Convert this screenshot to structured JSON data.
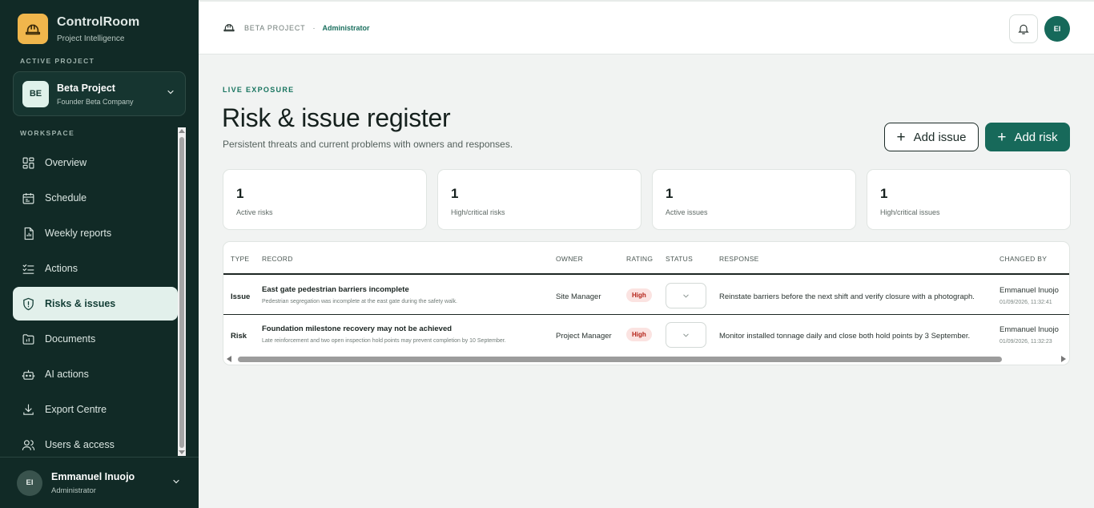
{
  "brand": {
    "name": "ControlRoom",
    "subtitle": "Project Intelligence",
    "icon": "hard-hat-icon",
    "color": "#f0b64c"
  },
  "sidebar": {
    "active_project_label": "ACTIVE PROJECT",
    "project": {
      "badge": "BE",
      "name": "Beta Project",
      "company": "Founder Beta Company"
    },
    "workspace_label": "WORKSPACE",
    "items": [
      {
        "label": "Overview",
        "icon": "grid-icon"
      },
      {
        "label": "Schedule",
        "icon": "calendar-icon"
      },
      {
        "label": "Weekly reports",
        "icon": "report-icon"
      },
      {
        "label": "Actions",
        "icon": "checklist-icon"
      },
      {
        "label": "Risks & issues",
        "icon": "shield-icon",
        "active": true
      },
      {
        "label": "Documents",
        "icon": "folder-icon"
      },
      {
        "label": "AI actions",
        "icon": "robot-icon"
      },
      {
        "label": "Export Centre",
        "icon": "download-icon"
      },
      {
        "label": "Users & access",
        "icon": "users-icon"
      }
    ],
    "user": {
      "initials": "EI",
      "name": "Emmanuel Inuojo",
      "role": "Administrator"
    }
  },
  "topbar": {
    "breadcrumb_project": "BETA PROJECT",
    "breadcrumb_separator": "·",
    "breadcrumb_role": "Administrator",
    "avatar_initials": "EI"
  },
  "page": {
    "eyebrow": "LIVE EXPOSURE",
    "title": "Risk & issue register",
    "subtitle": "Persistent threats and current problems with owners and responses.",
    "add_issue_label": "Add issue",
    "add_risk_label": "Add risk",
    "plus": "+"
  },
  "stats": [
    {
      "value": "1",
      "label": "Active risks"
    },
    {
      "value": "1",
      "label": "High/critical risks"
    },
    {
      "value": "1",
      "label": "Active issues"
    },
    {
      "value": "1",
      "label": "High/critical issues"
    }
  ],
  "table": {
    "headers": [
      "TYPE",
      "RECORD",
      "OWNER",
      "RATING",
      "STATUS",
      "RESPONSE",
      "CHANGED BY"
    ],
    "rows": [
      {
        "type": "Issue",
        "title": "East gate pedestrian barriers incomplete",
        "description": "Pedestrian segregation was incomplete at the east gate during the safety walk.",
        "owner": "Site Manager",
        "rating": "High",
        "response": "Reinstate barriers before the next shift and verify closure with a photograph.",
        "changed_by": "Emmanuel Inuojo",
        "changed_at": "01/09/2026, 11:32:41"
      },
      {
        "type": "Risk",
        "title": "Foundation milestone recovery may not be achieved",
        "description": "Late reinforcement and two open inspection hold points may prevent completion by 10 September.",
        "owner": "Project Manager",
        "rating": "High",
        "response": "Monitor installed tonnage daily and close both hold points by 3 September.",
        "changed_by": "Emmanuel Inuojo",
        "changed_at": "01/09/2026, 11:32:23"
      }
    ]
  },
  "colors": {
    "sidebar": "#112a26",
    "accent": "#17695a",
    "danger": "#b42318"
  }
}
